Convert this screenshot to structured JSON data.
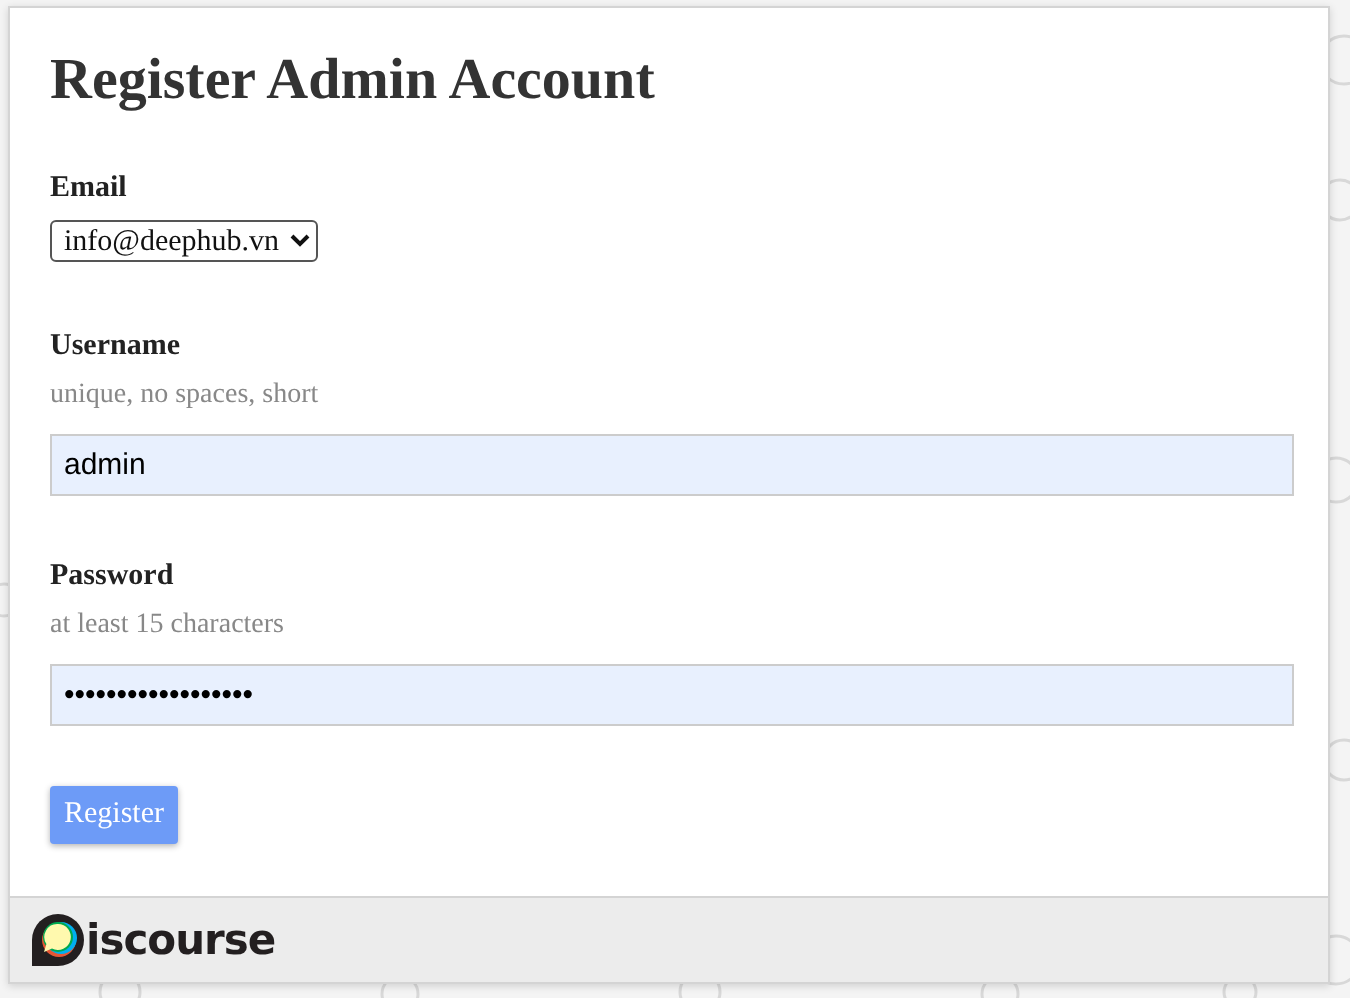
{
  "title": "Register Admin Account",
  "fields": [
    {
      "kind": "select",
      "label": "Email",
      "value": "info@deephub.vn"
    },
    {
      "kind": "text",
      "label": "Username",
      "hint": "unique, no spaces, short",
      "value": "admin"
    },
    {
      "kind": "text",
      "label": "Password",
      "hint": "at least 15 characters",
      "value": "••••••••••••••••••"
    }
  ],
  "button": "Register",
  "footer": {
    "logo_text": "iscourse"
  }
}
